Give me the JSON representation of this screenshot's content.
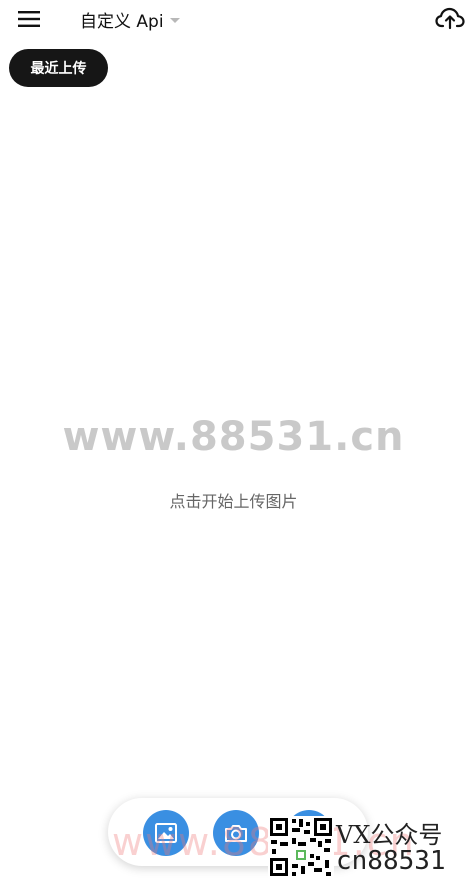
{
  "header": {
    "api_title": "自定义 Api",
    "icons": {
      "menu": "menu-icon",
      "upload": "cloud-upload-icon",
      "dropdown": "caret-down-icon"
    }
  },
  "recent_button": {
    "label": "最近上传"
  },
  "watermark": {
    "text": "www.88531.cn"
  },
  "empty_state": {
    "hint": "点击开始上传图片"
  },
  "fab_bar": {
    "icons": [
      "image-icon",
      "camera-icon",
      "circle-icon"
    ]
  },
  "promo": {
    "wx_label": "VX公众号",
    "site": "cn88531",
    "overlay_site": "www.88531.cn"
  },
  "colors": {
    "accent": "#3a8fe2",
    "dark_button": "#161616"
  }
}
